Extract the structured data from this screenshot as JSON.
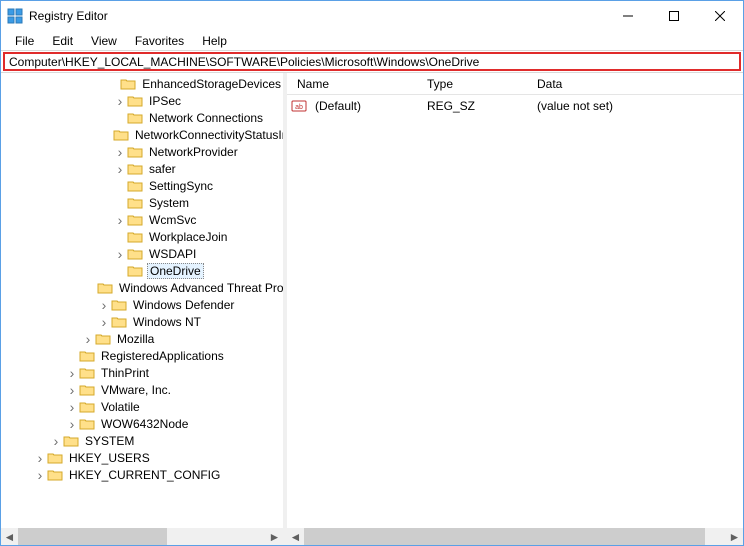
{
  "window": {
    "title": "Registry Editor"
  },
  "menu": {
    "items": [
      "File",
      "Edit",
      "View",
      "Favorites",
      "Help"
    ]
  },
  "addressbar": {
    "path": "Computer\\HKEY_LOCAL_MACHINE\\SOFTWARE\\Policies\\Microsoft\\Windows\\OneDrive"
  },
  "list": {
    "headers": {
      "name": "Name",
      "type": "Type",
      "data": "Data"
    },
    "rows": [
      {
        "icon": "string-value-icon",
        "name": "(Default)",
        "type": "REG_SZ",
        "data": "(value not set)"
      }
    ]
  },
  "tree": {
    "items": [
      {
        "indent": 7,
        "twist": "",
        "label": "EnhancedStorageDevices"
      },
      {
        "indent": 7,
        "twist": ">",
        "label": "IPSec"
      },
      {
        "indent": 7,
        "twist": "",
        "label": "Network Connections"
      },
      {
        "indent": 7,
        "twist": "",
        "label": "NetworkConnectivityStatusIndicator"
      },
      {
        "indent": 7,
        "twist": ">",
        "label": "NetworkProvider"
      },
      {
        "indent": 7,
        "twist": ">",
        "label": "safer"
      },
      {
        "indent": 7,
        "twist": "",
        "label": "SettingSync"
      },
      {
        "indent": 7,
        "twist": "",
        "label": "System"
      },
      {
        "indent": 7,
        "twist": ">",
        "label": "WcmSvc"
      },
      {
        "indent": 7,
        "twist": "",
        "label": "WorkplaceJoin"
      },
      {
        "indent": 7,
        "twist": ">",
        "label": "WSDAPI"
      },
      {
        "indent": 7,
        "twist": "",
        "label": "OneDrive",
        "selected": true
      },
      {
        "indent": 6,
        "twist": "",
        "label": "Windows Advanced Threat Protection"
      },
      {
        "indent": 6,
        "twist": ">",
        "label": "Windows Defender"
      },
      {
        "indent": 6,
        "twist": ">",
        "label": "Windows NT"
      },
      {
        "indent": 5,
        "twist": ">",
        "label": "Mozilla"
      },
      {
        "indent": 4,
        "twist": "",
        "label": "RegisteredApplications"
      },
      {
        "indent": 4,
        "twist": ">",
        "label": "ThinPrint"
      },
      {
        "indent": 4,
        "twist": ">",
        "label": "VMware, Inc."
      },
      {
        "indent": 4,
        "twist": ">",
        "label": "Volatile"
      },
      {
        "indent": 4,
        "twist": ">",
        "label": "WOW6432Node"
      },
      {
        "indent": 3,
        "twist": ">",
        "label": "SYSTEM"
      },
      {
        "indent": 2,
        "twist": ">",
        "label": "HKEY_USERS"
      },
      {
        "indent": 2,
        "twist": ">",
        "label": "HKEY_CURRENT_CONFIG"
      }
    ]
  }
}
